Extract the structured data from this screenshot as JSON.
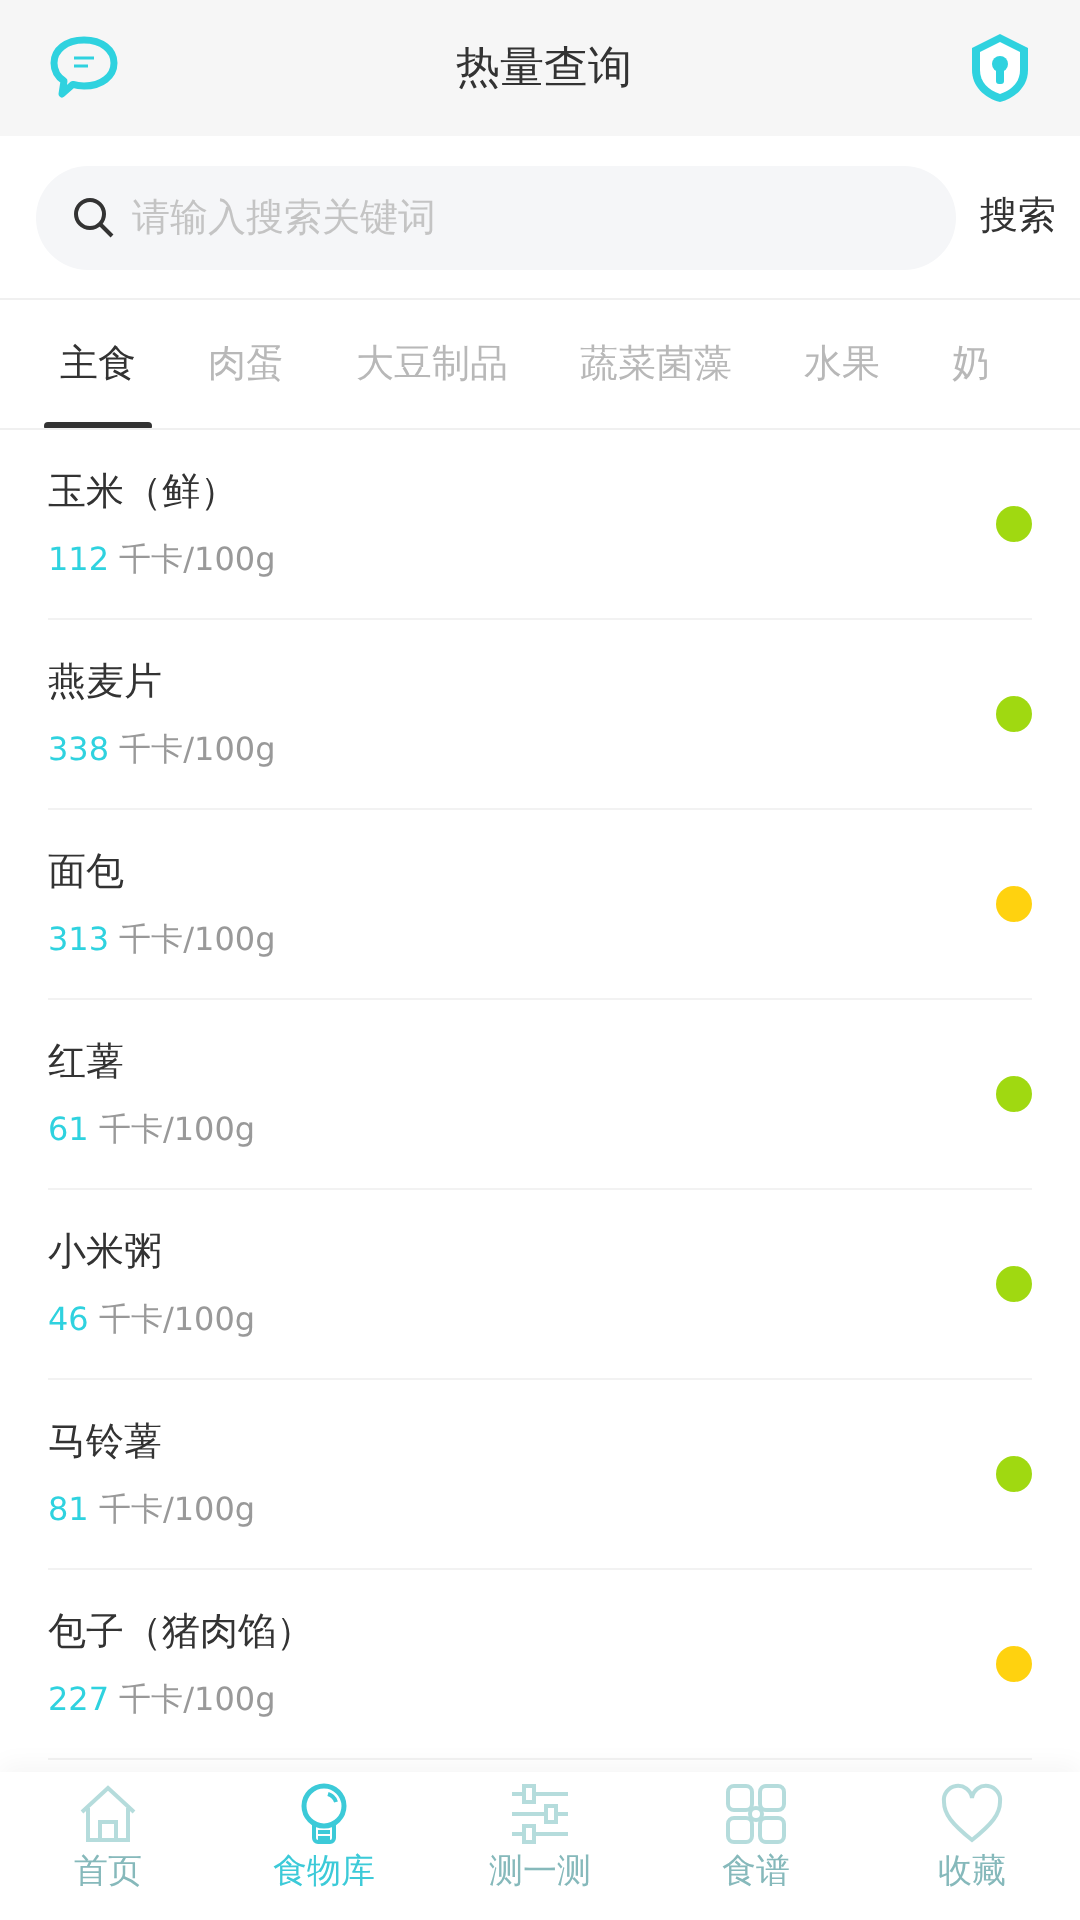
{
  "header": {
    "title": "热量查询"
  },
  "search": {
    "placeholder": "请输入搜索关键词",
    "button": "搜索"
  },
  "categories": [
    {
      "label": "主食",
      "selected": true
    },
    {
      "label": "肉蛋",
      "selected": false
    },
    {
      "label": "大豆制品",
      "selected": false
    },
    {
      "label": "蔬菜菌藻",
      "selected": false
    },
    {
      "label": "水果",
      "selected": false
    },
    {
      "label": "奶",
      "selected": false
    }
  ],
  "foods": [
    {
      "name": "玉米（鲜）",
      "calories": "112",
      "unit": "千卡/100g",
      "color": "#a0d911"
    },
    {
      "name": "燕麦片",
      "calories": "338",
      "unit": "千卡/100g",
      "color": "#a0d911"
    },
    {
      "name": "面包",
      "calories": "313",
      "unit": "千卡/100g",
      "color": "#ffd20f"
    },
    {
      "name": "红薯",
      "calories": "61",
      "unit": "千卡/100g",
      "color": "#a0d911"
    },
    {
      "name": "小米粥",
      "calories": "46",
      "unit": "千卡/100g",
      "color": "#a0d911"
    },
    {
      "name": "马铃薯",
      "calories": "81",
      "unit": "千卡/100g",
      "color": "#a0d911"
    },
    {
      "name": "包子（猪肉馅）",
      "calories": "227",
      "unit": "千卡/100g",
      "color": "#ffd20f"
    }
  ],
  "tab_bar": [
    {
      "kind": "home",
      "label": "首页",
      "selected": false
    },
    {
      "kind": "bulb",
      "label": "食物库",
      "selected": true
    },
    {
      "kind": "sliders",
      "label": "测一测",
      "selected": false
    },
    {
      "kind": "grid",
      "label": "食谱",
      "selected": false
    },
    {
      "kind": "heart",
      "label": "收藏",
      "selected": false
    }
  ]
}
